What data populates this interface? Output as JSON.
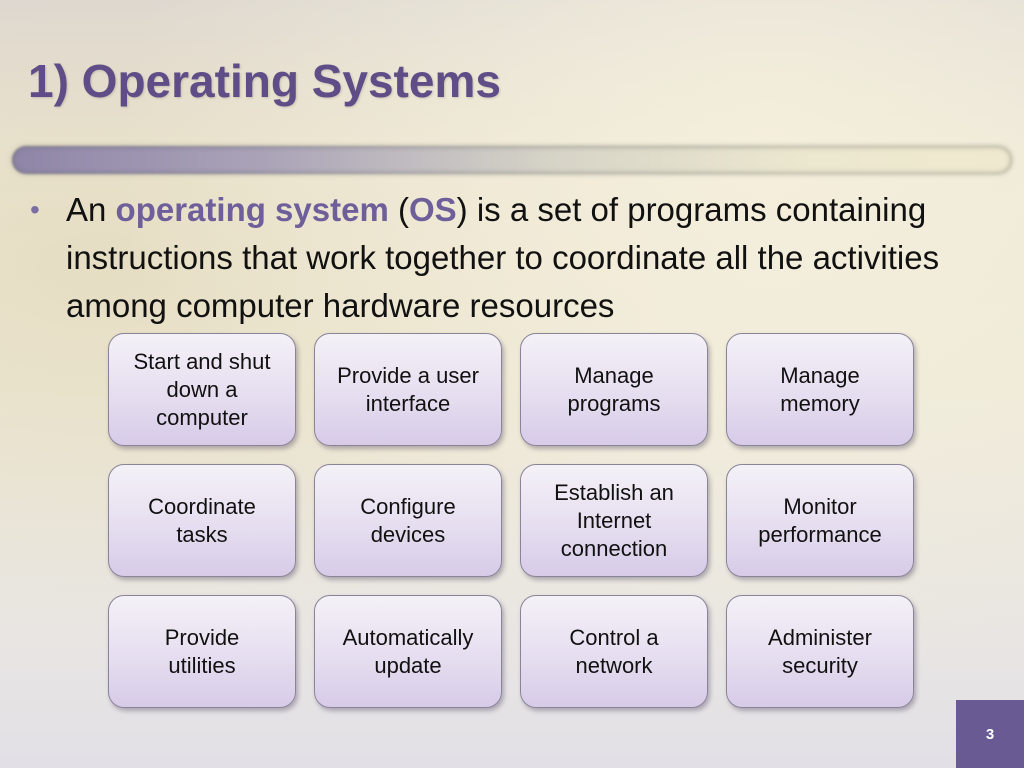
{
  "slide": {
    "title": "1) Operating Systems",
    "bullet": {
      "prefix": "An ",
      "term": "operating system",
      "paren_open": " (",
      "abbr": "OS",
      "rest": ") is a set of programs containing instructions that work together to coordinate all the activities among computer hardware resources"
    },
    "functions": [
      "Start and shut\ndown a\ncomputer",
      "Provide a user\ninterface",
      "Manage\nprograms",
      "Manage\nmemory",
      "Coordinate\ntasks",
      "Configure\ndevices",
      "Establish an\nInternet\nconnection",
      "Monitor\nperformance",
      "Provide\nutilities",
      "Automatically\nupdate",
      "Control a\nnetwork",
      "Administer\nsecurity"
    ],
    "page_number": "3"
  },
  "colors": {
    "accent": "#5e4d86",
    "page_badge": "#6a5a93"
  }
}
